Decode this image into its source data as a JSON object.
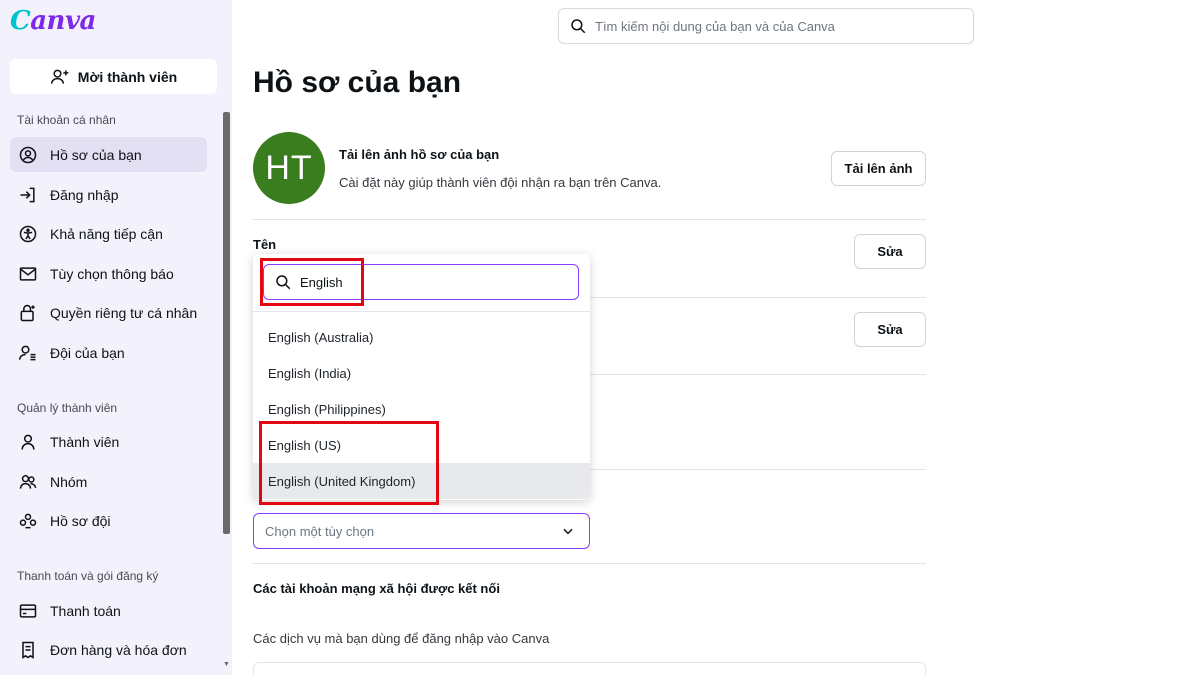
{
  "sidebar": {
    "logo": "Canva",
    "invite_label": "Mời thành viên",
    "sections": {
      "personal": "Tài khoản cá nhân",
      "members": "Quản lý thành viên",
      "billing": "Thanh toán và gói đăng ký"
    },
    "items": {
      "profile": "Hồ sơ của bạn",
      "login": "Đăng nhập",
      "accessibility": "Khả năng tiếp cận",
      "notifications": "Tùy chọn thông báo",
      "privacy": "Quyền riêng tư cá nhân",
      "team": "Đội của bạn",
      "members": "Thành viên",
      "groups": "Nhóm",
      "team_profile": "Hồ sơ đội",
      "payment": "Thanh toán",
      "orders": "Đơn hàng và hóa đơn"
    }
  },
  "search": {
    "placeholder": "Tìm kiếm nội dung của bạn và của Canva"
  },
  "main": {
    "title": "Hồ sơ của bạn",
    "avatar_initials": "HT",
    "avatar_color": "#3a7d1f",
    "upload_title": "Tải lên ảnh hồ sơ của bạn",
    "upload_desc": "Cài đặt này giúp thành viên đội nhận ra bạn trên Canva.",
    "upload_button": "Tải lên ảnh",
    "name_label": "Tên",
    "edit_button": "Sửa",
    "select_placeholder": "Chọn một tùy chọn",
    "social_title": "Các tài khoản mạng xã hội được kết nối",
    "social_desc": "Các dịch vụ mà bạn dùng để đăng nhập vào Canva"
  },
  "dropdown": {
    "search_value": "English",
    "options": [
      "English (Australia)",
      "English (India)",
      "English (Philippines)",
      "English (US)",
      "English (United Kingdom)"
    ],
    "hovered_index": 4
  },
  "colors": {
    "accent": "#8b3dff",
    "annotation": "#e30613",
    "sidebar_bg": "#f3f1fb"
  }
}
